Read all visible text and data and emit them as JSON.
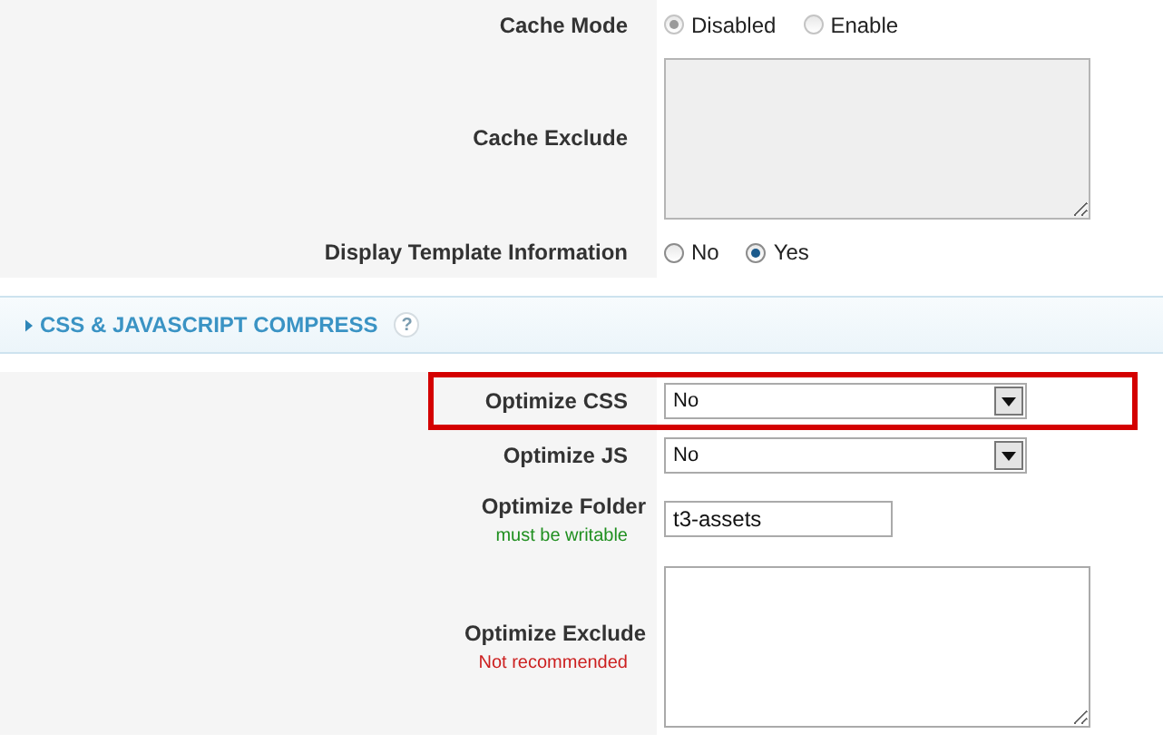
{
  "general_fields": [
    {
      "kind": "radio",
      "label": "Cache Mode",
      "disabled": true,
      "options": [
        {
          "label": "Disabled",
          "selected": true
        },
        {
          "label": "Enable",
          "selected": false
        }
      ]
    },
    {
      "kind": "textarea",
      "label": "Cache Exclude",
      "disabled": true
    },
    {
      "kind": "radio",
      "label": "Display Template Information",
      "disabled": false,
      "options": [
        {
          "label": "No",
          "selected": false
        },
        {
          "label": "Yes",
          "selected": true
        }
      ]
    }
  ],
  "section": {
    "title": "CSS & JAVASCRIPT COMPRESS",
    "help": "?"
  },
  "section_fields": [
    {
      "kind": "select",
      "label": "Optimize CSS",
      "value": "No",
      "highlighted": true
    },
    {
      "kind": "select",
      "label": "Optimize JS",
      "value": "No",
      "highlighted": false
    },
    {
      "kind": "text",
      "label": "Optimize Folder",
      "value": "t3-assets",
      "note": {
        "text": "must be writable",
        "color": "#1f8f1f"
      }
    },
    {
      "kind": "textarea",
      "label": "Optimize Exclude",
      "disabled": false,
      "note": {
        "text": "Not recommended",
        "color": "#cc1f1f"
      }
    }
  ]
}
